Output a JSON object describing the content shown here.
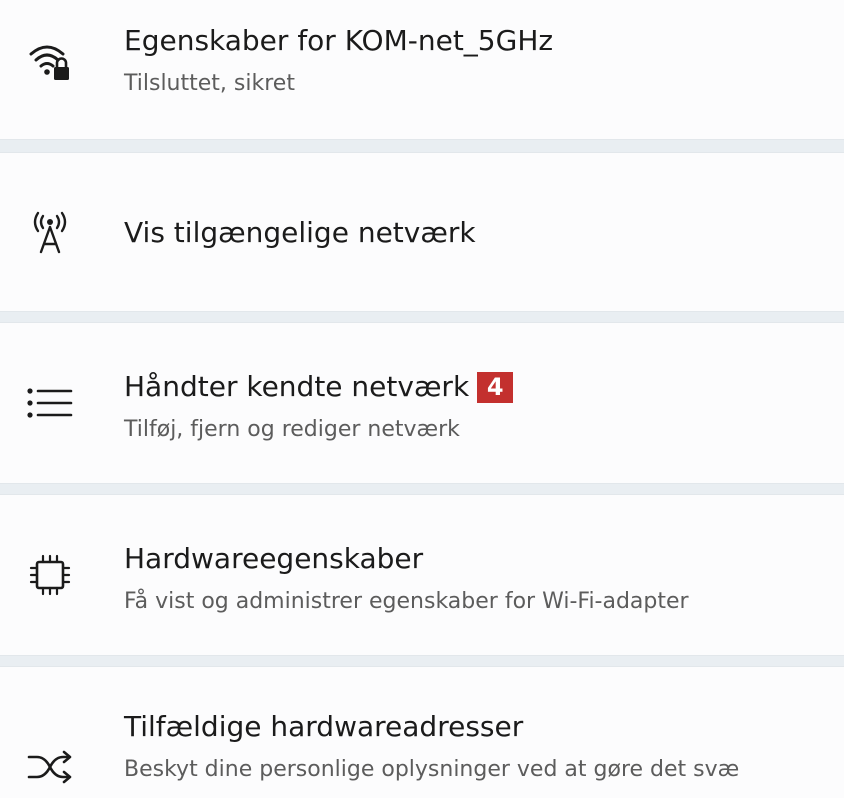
{
  "rows": [
    {
      "title": "Egenskaber for KOM-net_5GHz",
      "subtitle": "Tilsluttet, sikret",
      "icon": "wifi-lock-icon"
    },
    {
      "title": "Vis tilgængelige netværk",
      "icon": "antenna-icon"
    },
    {
      "title": "Håndter kendte netværk",
      "subtitle": "Tilføj, fjern og rediger netværk",
      "badge": "4",
      "icon": "list-icon"
    },
    {
      "title": "Hardwareegenskaber",
      "subtitle": "Få vist og administrer egenskaber for Wi-Fi-adapter",
      "icon": "chip-icon"
    },
    {
      "title": "Tilfældige hardwareadresser",
      "subtitle": "Beskyt dine personlige oplysninger ved at gøre det svæ",
      "icon": "shuffle-icon"
    }
  ],
  "colors": {
    "background": "#e9eef2",
    "card": "#fcfcfd",
    "badge": "#c3302e"
  }
}
